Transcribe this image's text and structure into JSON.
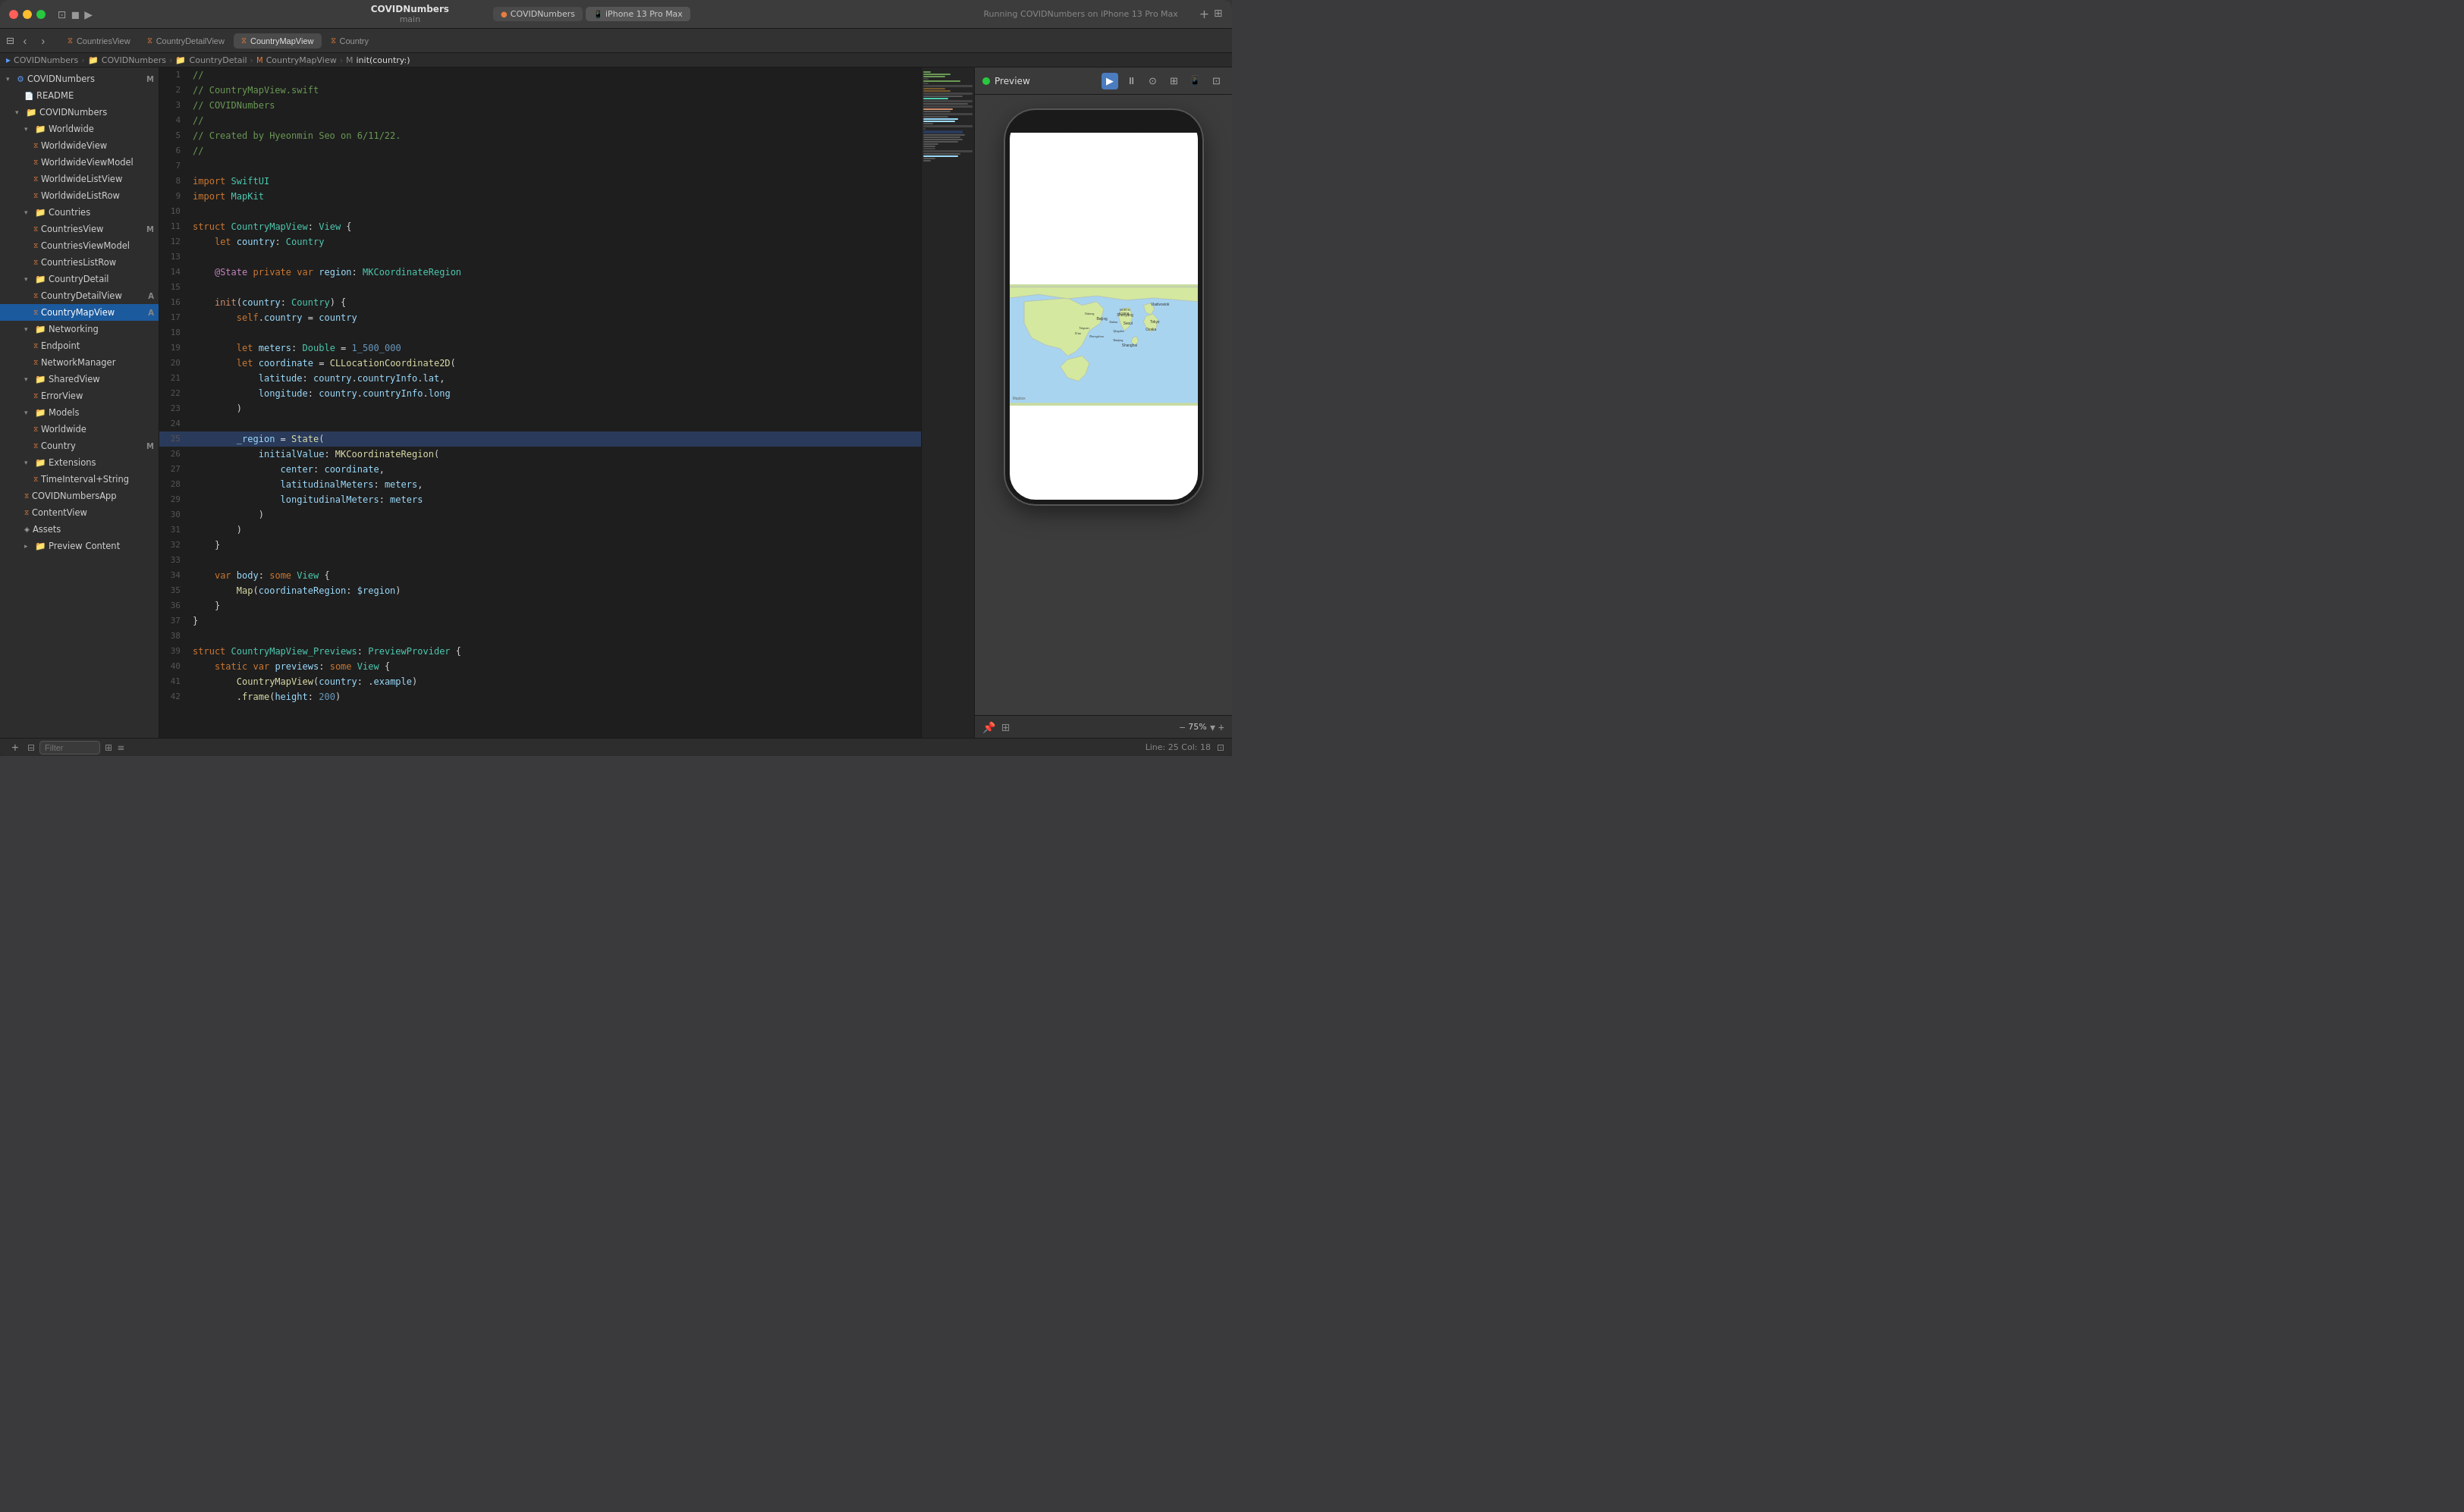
{
  "window": {
    "title": "COVIDNumbers",
    "subtitle": "main"
  },
  "titlebar": {
    "tabs": [
      {
        "id": "covidnumbers",
        "label": "COVIDNumbers",
        "icon": "swift",
        "active": false
      },
      {
        "id": "iphone",
        "label": "iPhone 13 Pro Max",
        "icon": "device",
        "active": true
      }
    ],
    "running_label": "Running COVIDNumbers on iPhone 13 Pro Max",
    "add_tab_label": "+",
    "layout_label": "⊞"
  },
  "toolbar2": {
    "nav_back": "‹",
    "nav_forward": "›",
    "tabs": [
      {
        "id": "countries-view",
        "label": "CountriesView",
        "icon": "swift"
      },
      {
        "id": "country-detail-view",
        "label": "CountryDetailView",
        "icon": "swift"
      },
      {
        "id": "country-map-view",
        "label": "CountryMapView",
        "icon": "swift",
        "active": true
      },
      {
        "id": "country",
        "label": "Country",
        "icon": "swift"
      }
    ]
  },
  "breadcrumb": {
    "items": [
      "COVIDNumbers",
      "COVIDNumbers",
      "CountryDetail",
      "CountryMapView",
      "init(country:)"
    ]
  },
  "sidebar": {
    "project_name": "COVIDNumbers",
    "badge": "M",
    "items": [
      {
        "id": "readme",
        "label": "README",
        "indent": 2,
        "type": "file",
        "icon": "doc"
      },
      {
        "id": "covidnumbers-group",
        "label": "COVIDNumbers",
        "indent": 1,
        "type": "group",
        "expanded": true
      },
      {
        "id": "worldwide-group",
        "label": "Worldwide",
        "indent": 2,
        "type": "group",
        "expanded": true
      },
      {
        "id": "worldwideview",
        "label": "WorldwideView",
        "indent": 3,
        "type": "swift"
      },
      {
        "id": "worldwideviewmodel",
        "label": "WorldwideViewModel",
        "indent": 3,
        "type": "swift"
      },
      {
        "id": "worldwidelistview",
        "label": "WorldwideListView",
        "indent": 3,
        "type": "swift"
      },
      {
        "id": "worldwidelistrow",
        "label": "WorldwideListRow",
        "indent": 3,
        "type": "swift"
      },
      {
        "id": "countries-group",
        "label": "Countries",
        "indent": 2,
        "type": "group",
        "expanded": true
      },
      {
        "id": "countriesview",
        "label": "CountriesView",
        "indent": 3,
        "type": "swift",
        "badge": "M"
      },
      {
        "id": "countriesviewmodel",
        "label": "CountriesViewModel",
        "indent": 3,
        "type": "swift"
      },
      {
        "id": "countrieslistrow",
        "label": "CountriesListRow",
        "indent": 3,
        "type": "swift"
      },
      {
        "id": "countrydetail-group",
        "label": "CountryDetail",
        "indent": 2,
        "type": "group",
        "expanded": true
      },
      {
        "id": "countrydetailview",
        "label": "CountryDetailView",
        "indent": 3,
        "type": "swift",
        "badge": "A"
      },
      {
        "id": "countrymapview",
        "label": "CountryMapView",
        "indent": 3,
        "type": "swift",
        "badge": "A",
        "selected": true
      },
      {
        "id": "networking-group",
        "label": "Networking",
        "indent": 2,
        "type": "group",
        "expanded": true
      },
      {
        "id": "endpoint",
        "label": "Endpoint",
        "indent": 3,
        "type": "swift"
      },
      {
        "id": "networkmanager",
        "label": "NetworkManager",
        "indent": 3,
        "type": "swift"
      },
      {
        "id": "sharedview-group",
        "label": "SharedView",
        "indent": 2,
        "type": "group",
        "expanded": true
      },
      {
        "id": "errorview",
        "label": "ErrorView",
        "indent": 3,
        "type": "swift"
      },
      {
        "id": "models-group",
        "label": "Models",
        "indent": 2,
        "type": "group",
        "expanded": true
      },
      {
        "id": "worldwide",
        "label": "Worldwide",
        "indent": 3,
        "type": "swift"
      },
      {
        "id": "country",
        "label": "Country",
        "indent": 3,
        "type": "swift",
        "badge": "M"
      },
      {
        "id": "extensions-group",
        "label": "Extensions",
        "indent": 2,
        "type": "group",
        "expanded": true
      },
      {
        "id": "timeinterval-string",
        "label": "TimeInterval+String",
        "indent": 3,
        "type": "swift"
      },
      {
        "id": "covidnumbersapp",
        "label": "COVIDNumbersApp",
        "indent": 2,
        "type": "swift"
      },
      {
        "id": "contentview",
        "label": "ContentView",
        "indent": 2,
        "type": "swift"
      },
      {
        "id": "assets",
        "label": "Assets",
        "indent": 2,
        "type": "asset"
      },
      {
        "id": "preview-content",
        "label": "Preview Content",
        "indent": 2,
        "type": "group"
      }
    ]
  },
  "code": {
    "filename": "CountryMapView.swift",
    "lines": [
      {
        "num": 1,
        "text": "//"
      },
      {
        "num": 2,
        "text": "// CountryMapView.swift"
      },
      {
        "num": 3,
        "text": "// COVIDNumbers"
      },
      {
        "num": 4,
        "text": "//"
      },
      {
        "num": 5,
        "text": "// Created by Hyeonmin Seo on 6/11/22."
      },
      {
        "num": 6,
        "text": "//"
      },
      {
        "num": 7,
        "text": ""
      },
      {
        "num": 8,
        "text": "import SwiftUI"
      },
      {
        "num": 9,
        "text": "import MapKit"
      },
      {
        "num": 10,
        "text": ""
      },
      {
        "num": 11,
        "text": "struct CountryMapView: View {"
      },
      {
        "num": 12,
        "text": "    let country: Country"
      },
      {
        "num": 13,
        "text": ""
      },
      {
        "num": 14,
        "text": "    @State private var region: MKCoordinateRegion"
      },
      {
        "num": 15,
        "text": ""
      },
      {
        "num": 16,
        "text": "    init(country: Country) {"
      },
      {
        "num": 17,
        "text": "        self.country = country"
      },
      {
        "num": 18,
        "text": ""
      },
      {
        "num": 19,
        "text": "        let meters: Double = 1_500_000"
      },
      {
        "num": 20,
        "text": "        let coordinate = CLLocationCoordinate2D("
      },
      {
        "num": 21,
        "text": "            latitude: country.countryInfo.lat,"
      },
      {
        "num": 22,
        "text": "            longitude: country.countryInfo.long"
      },
      {
        "num": 23,
        "text": "        )"
      },
      {
        "num": 24,
        "text": ""
      },
      {
        "num": 25,
        "text": "        _region = State(",
        "highlighted": true
      },
      {
        "num": 26,
        "text": "            initialValue: MKCoordinateRegion("
      },
      {
        "num": 27,
        "text": "                center: coordinate,"
      },
      {
        "num": 28,
        "text": "                latitudinalMeters: meters,"
      },
      {
        "num": 29,
        "text": "                longitudinalMeters: meters"
      },
      {
        "num": 30,
        "text": "            )"
      },
      {
        "num": 31,
        "text": "        )"
      },
      {
        "num": 32,
        "text": "    }"
      },
      {
        "num": 33,
        "text": ""
      },
      {
        "num": 34,
        "text": "    var body: some View {"
      },
      {
        "num": 35,
        "text": "        Map(coordinateRegion: $region)"
      },
      {
        "num": 36,
        "text": "    }"
      },
      {
        "num": 37,
        "text": "}"
      },
      {
        "num": 38,
        "text": ""
      },
      {
        "num": 39,
        "text": "struct CountryMapView_Previews: PreviewProvider {"
      },
      {
        "num": 40,
        "text": "    static var previews: some View {"
      },
      {
        "num": 41,
        "text": "        CountryMapView(country: .example)"
      },
      {
        "num": 42,
        "text": "        .frame(height: 200)"
      }
    ]
  },
  "preview": {
    "label": "Preview",
    "active": true,
    "phone_model": "iPhone 13 Pro Max",
    "zoom": "75%",
    "line_col": "Line: 25  Col: 18"
  },
  "statusbar": {
    "filter_placeholder": "Filter",
    "add_label": "+",
    "icons": [
      "⊞",
      "≡"
    ]
  }
}
